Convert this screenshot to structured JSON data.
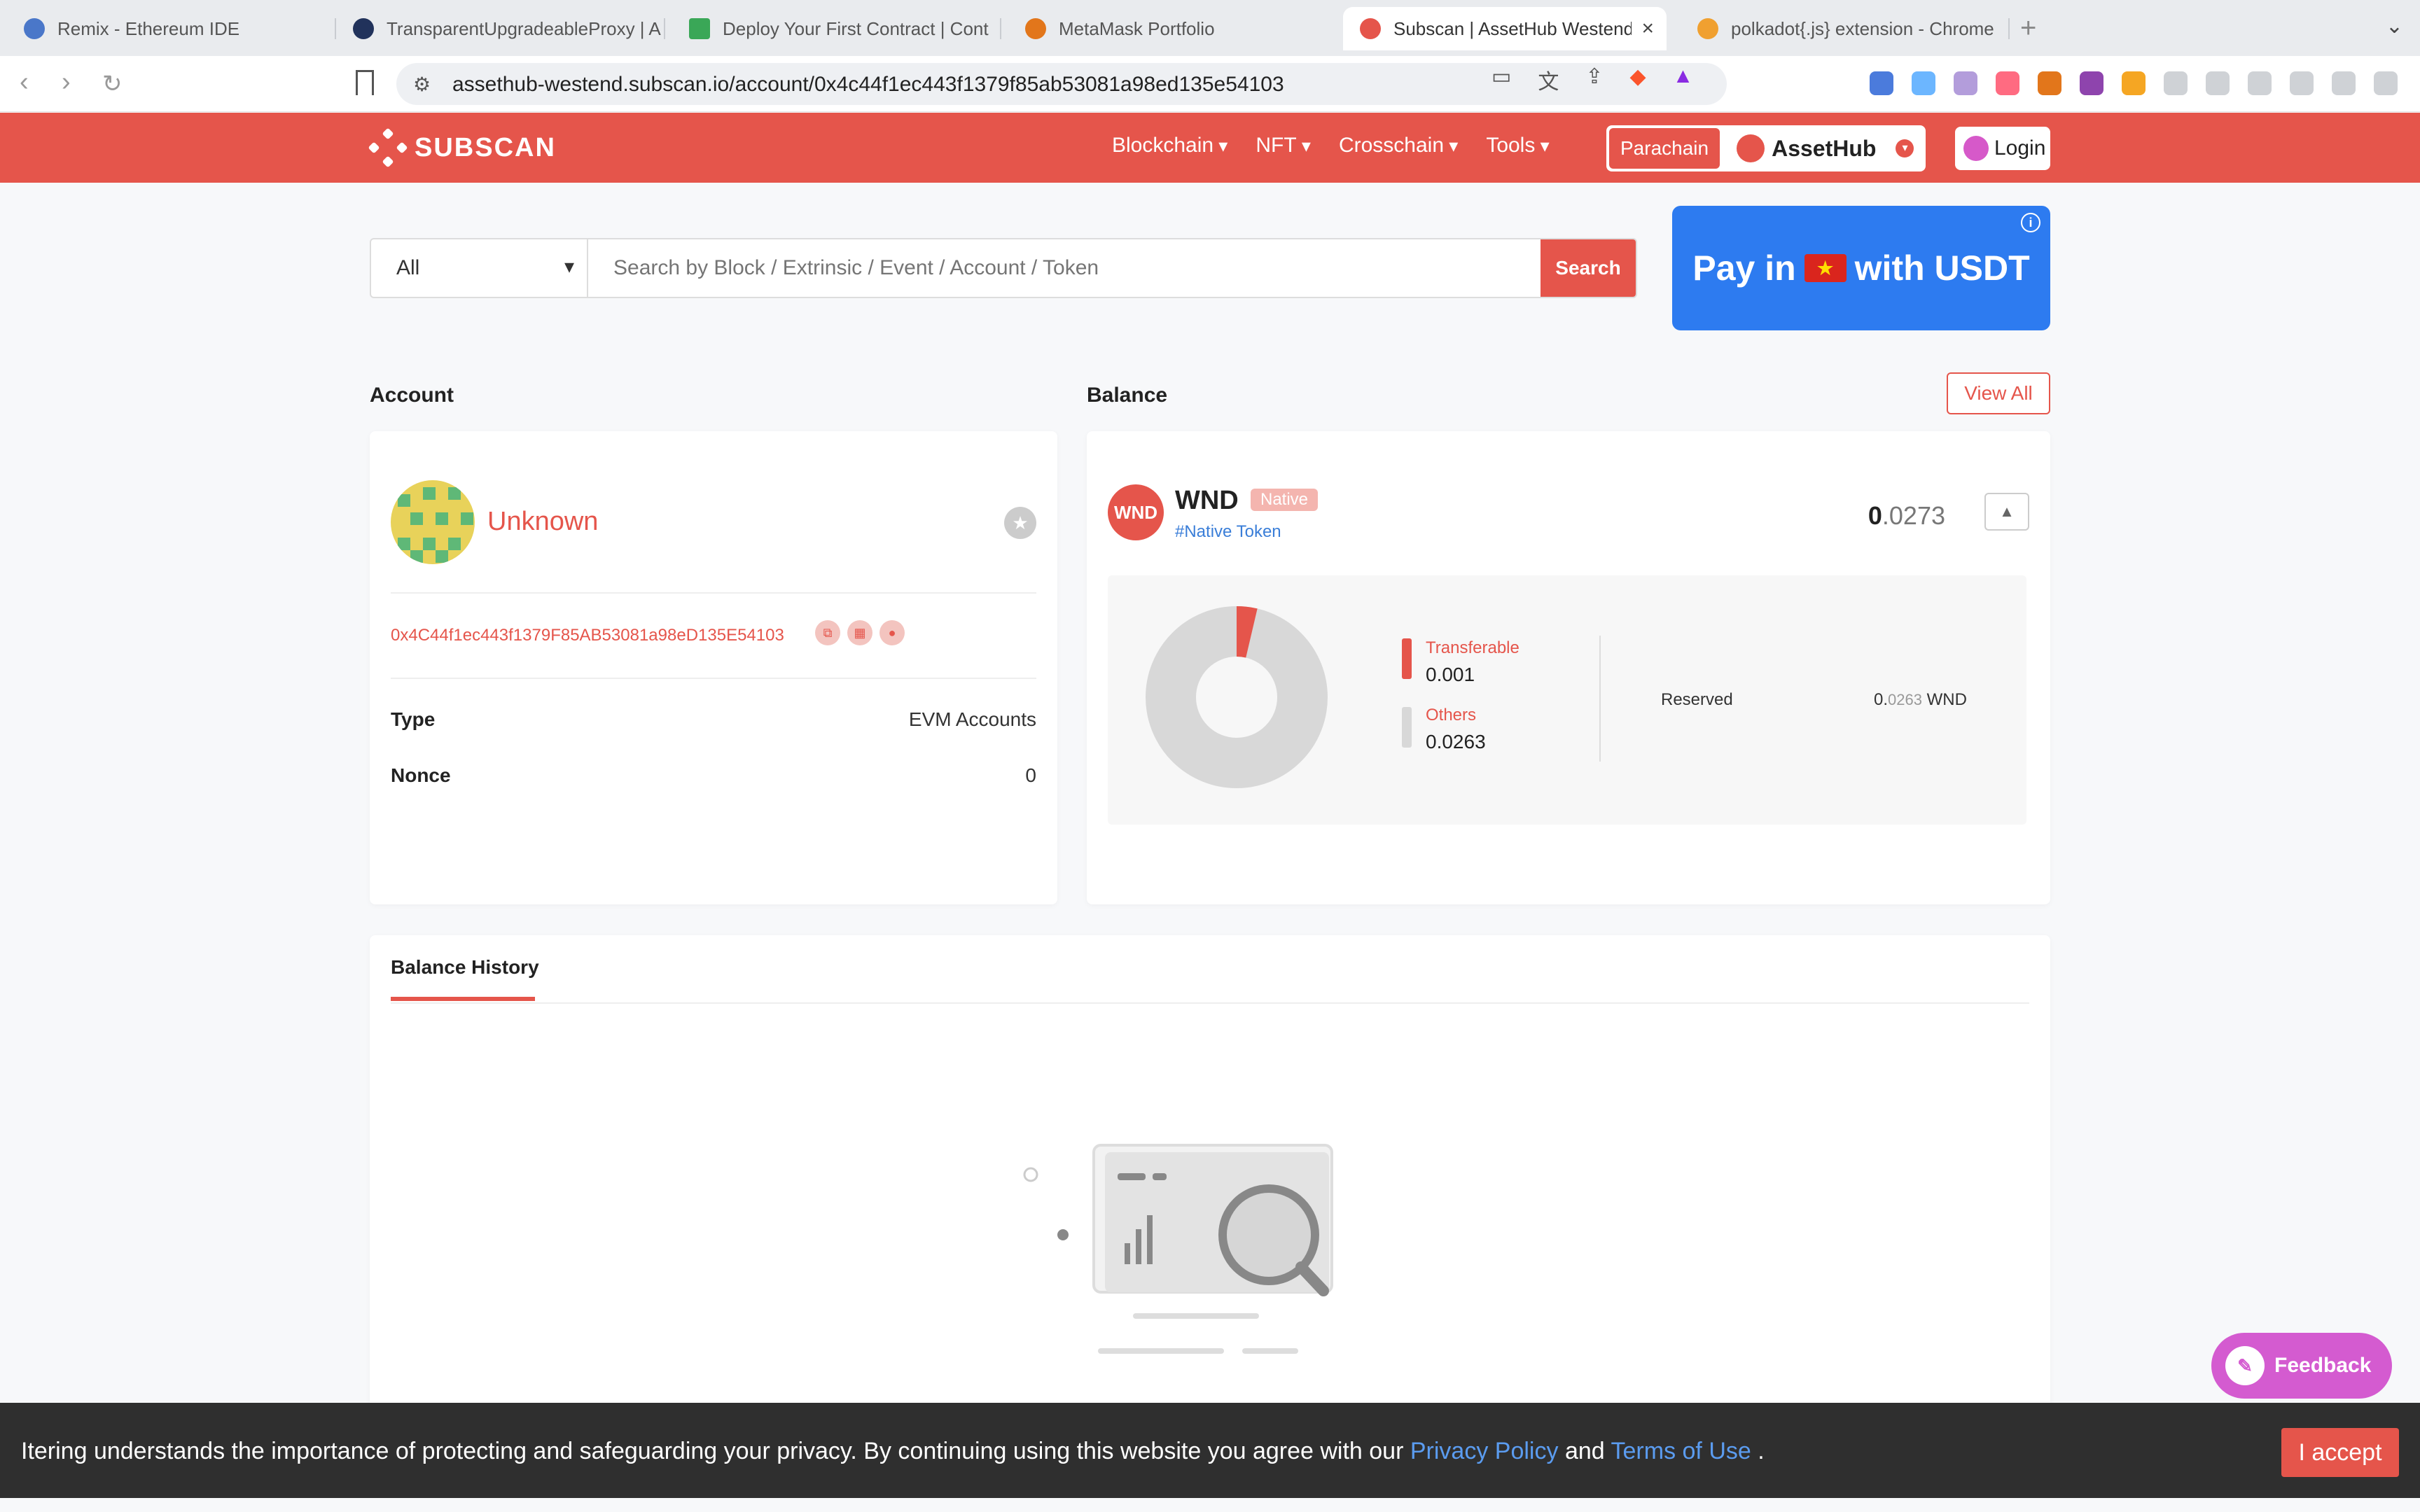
{
  "browser": {
    "tabs": [
      {
        "title": "Remix - Ethereum IDE",
        "favicon_color": "#4a77c9",
        "active": false
      },
      {
        "title": "TransparentUpgradeableProxy | A",
        "favicon_color": "#21325b",
        "active": false
      },
      {
        "title": "Deploy Your First Contract | Cont",
        "favicon_color": "#3aa757",
        "active": false
      },
      {
        "title": "MetaMask Portfolio",
        "favicon_color": "#e2761b",
        "active": false
      },
      {
        "title": "Subscan | AssetHub Westend",
        "favicon_color": "#e5554b",
        "active": true
      },
      {
        "title": "polkadot{.js} extension - Chrome",
        "favicon_color": "#f0a030",
        "active": false
      }
    ],
    "new_tab_glyph": "+",
    "url": "assethub-westend.subscan.io/account/0x4c44f1ec443f1379f85ab53081a98ed135e54103",
    "icons": [
      "back-icon",
      "forward-icon",
      "reload-icon",
      "bookmark-icon",
      "site-info-icon",
      "cast-icon",
      "translate-icon",
      "share-icon",
      "brave-shield-icon",
      "brave-rewards-icon"
    ]
  },
  "header": {
    "logo_text": "SUBSCAN",
    "menu": [
      "Blockchain",
      "NFT",
      "Crosschain",
      "Tools"
    ],
    "network_type": "Parachain",
    "network_name": "AssetHub",
    "login_label": "Login",
    "brand_color": "#e5554b"
  },
  "search": {
    "category": "All",
    "placeholder": "Search by Block / Extrinsic / Event / Account / Token",
    "button_label": "Search"
  },
  "ad": {
    "text_before": "Pay in",
    "text_after": "with USDT",
    "flag_glyph": "★",
    "info_glyph": "i"
  },
  "account": {
    "section_title": "Account",
    "name": "Unknown",
    "address": "0x4C44f1ec443f1379F85AB53081a98eD135E54103",
    "type_label": "Type",
    "type_value": "EVM Accounts",
    "nonce_label": "Nonce",
    "nonce_value": "0"
  },
  "balance": {
    "section_title": "Balance",
    "view_all_label": "View All",
    "token_logo_text": "WND",
    "token_symbol": "WND",
    "badge": "Native",
    "tag": "#Native Token",
    "total_int": "0",
    "total_frac": ".0273",
    "transferable_label": "Transferable",
    "transferable_value": "0.001",
    "others_label": "Others",
    "others_value": "0.0263",
    "reserved_label": "Reserved",
    "reserved_int": "0.",
    "reserved_frac": "0263",
    "reserved_unit": "WND",
    "transferable_color": "#e5554b",
    "others_color": "#d8d8d8"
  },
  "balance_history": {
    "tab_label": "Balance History"
  },
  "cookie": {
    "message": "Itering understands the importance of protecting and safeguarding your privacy. By continuing using this website you agree with our",
    "privacy_link": "Privacy Policy",
    "and_text": "and",
    "terms_link": "Terms of Use",
    "end_text": ".",
    "accept_label": "I accept"
  },
  "feedback": {
    "label": "Feedback"
  }
}
